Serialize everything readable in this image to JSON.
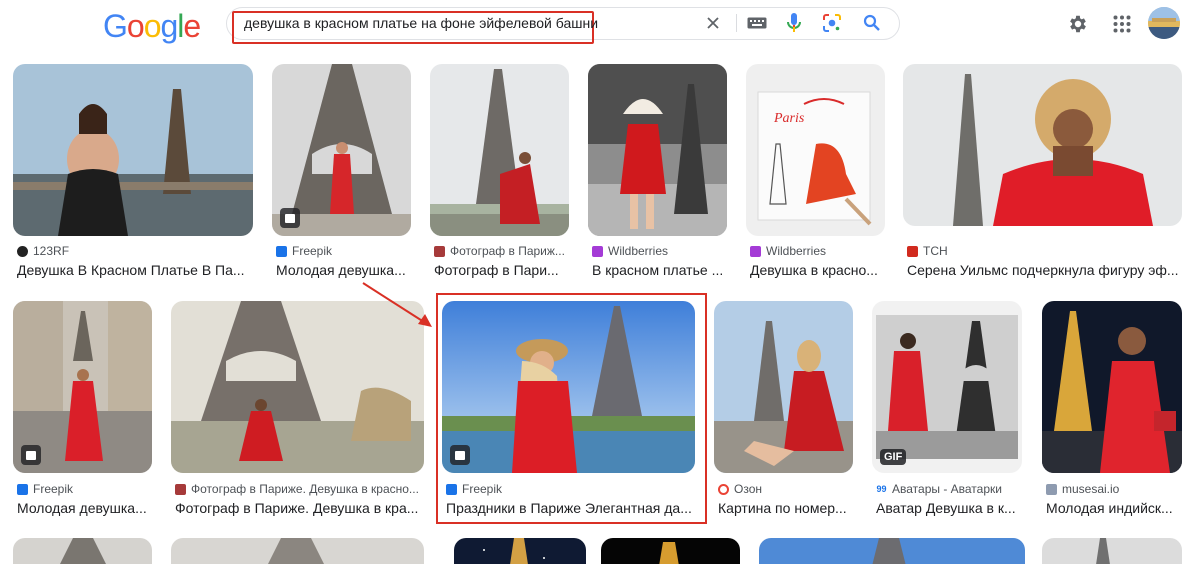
{
  "logo": {
    "letters": [
      "G",
      "o",
      "o",
      "g",
      "l",
      "e"
    ]
  },
  "search": {
    "query": "девушка в красном платье на фоне эйфелевой башни"
  },
  "header_icons": [
    "close-icon",
    "keyboard-icon",
    "mic-icon",
    "lens-icon",
    "search-icon",
    "gear-icon",
    "apps-icon"
  ],
  "results": [
    {
      "source": "123RF",
      "title": "Девушка В Красном Платье В Па..."
    },
    {
      "source": "Freepik",
      "title": "Молодая девушка..."
    },
    {
      "source": "Фотограф в Париж...",
      "title": "Фотограф в Пари..."
    },
    {
      "source": "Wildberries",
      "title": "В красном платье ..."
    },
    {
      "source": "Wildberries",
      "title": "Девушка в красно..."
    },
    {
      "source": "TCH",
      "title": "Серена Уильмс подчеркнула фигуру эф..."
    },
    {
      "source": "Freepik",
      "title": "Молодая девушка..."
    },
    {
      "source": "Фотограф в Париже. Девушка в красно...",
      "title": "Фотограф в Париже. Девушка в кра..."
    },
    {
      "source": "Freepik",
      "title": "Праздники в Париже Элегантная да..."
    },
    {
      "source": "Озон",
      "title": "Картина по номер..."
    },
    {
      "source": "Аватары - Аватарки",
      "title": "Аватар Девушка в к..."
    },
    {
      "source": "musesai.io",
      "title": "Молодая индийск..."
    }
  ],
  "gif_label": "GIF",
  "colors": {
    "highlight": "#d93025",
    "blue": "#4285f4",
    "red": "#ea4335",
    "yellow": "#fbbc05",
    "green": "#34a853"
  }
}
